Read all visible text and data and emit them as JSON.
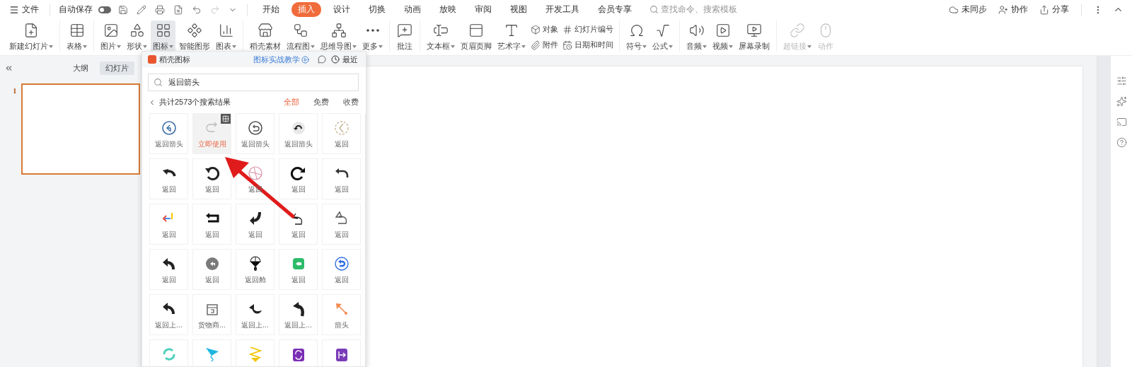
{
  "titlebar": {
    "menu": "文件",
    "autosave": {
      "label": "自动保存",
      "on": false
    },
    "tabs": [
      {
        "label": "开始",
        "selected": false
      },
      {
        "label": "插入",
        "selected": true
      },
      {
        "label": "设计",
        "selected": false
      },
      {
        "label": "切换",
        "selected": false
      },
      {
        "label": "动画",
        "selected": false
      },
      {
        "label": "放映",
        "selected": false
      },
      {
        "label": "审阅",
        "selected": false
      },
      {
        "label": "视图",
        "selected": false
      },
      {
        "label": "开发工具",
        "selected": false
      },
      {
        "label": "会员专享",
        "selected": false
      }
    ],
    "search": {
      "placeholder": "查找命令、搜索模板"
    },
    "actions": [
      "未同步",
      "协作",
      "分享"
    ]
  },
  "ribbon": [
    {
      "items": [
        {
          "kind": "large",
          "label": "新建幻灯片",
          "dropdown": true,
          "active": false,
          "disabled": false
        }
      ]
    },
    {
      "items": [
        {
          "kind": "large",
          "label": "表格",
          "dropdown": true,
          "active": false,
          "disabled": false
        }
      ]
    },
    {
      "items": [
        {
          "kind": "large",
          "label": "图片",
          "dropdown": true,
          "active": false,
          "disabled": false
        },
        {
          "kind": "large",
          "label": "形状",
          "dropdown": true,
          "active": false,
          "disabled": false
        },
        {
          "kind": "large",
          "label": "图标",
          "dropdown": true,
          "active": true,
          "disabled": false
        },
        {
          "kind": "large",
          "label": "智能图形",
          "dropdown": false,
          "active": false,
          "disabled": false
        },
        {
          "kind": "large",
          "label": "图表",
          "dropdown": true,
          "active": false,
          "disabled": false
        }
      ]
    },
    {
      "items": [
        {
          "kind": "large",
          "label": "稻壳素材",
          "dropdown": false,
          "active": false,
          "disabled": false
        },
        {
          "kind": "large",
          "label": "流程图",
          "dropdown": true,
          "active": false,
          "disabled": false
        },
        {
          "kind": "large",
          "label": "思维导图",
          "dropdown": true,
          "active": false,
          "disabled": false
        },
        {
          "kind": "large",
          "label": "更多",
          "dropdown": true,
          "active": false,
          "disabled": false
        }
      ]
    },
    {
      "items": [
        {
          "kind": "large",
          "label": "批注",
          "dropdown": false,
          "active": false,
          "disabled": false
        }
      ]
    },
    {
      "items": [
        {
          "kind": "large",
          "label": "文本框",
          "dropdown": true,
          "active": false,
          "disabled": false
        },
        {
          "kind": "large",
          "label": "页眉页脚",
          "dropdown": false,
          "active": false,
          "disabled": false
        },
        {
          "kind": "large",
          "label": "艺术字",
          "dropdown": true,
          "active": false,
          "disabled": false
        },
        {
          "kind": "stack",
          "rows": [
            "对象",
            "附件"
          ]
        },
        {
          "kind": "stack",
          "rows": [
            "幻灯片编号",
            "日期和时间"
          ]
        }
      ]
    },
    {
      "items": [
        {
          "kind": "large",
          "label": "符号",
          "dropdown": true,
          "active": false,
          "disabled": false
        },
        {
          "kind": "large",
          "label": "公式",
          "dropdown": true,
          "active": false,
          "disabled": false
        }
      ]
    },
    {
      "items": [
        {
          "kind": "large",
          "label": "音频",
          "dropdown": true,
          "active": false,
          "disabled": false
        },
        {
          "kind": "large",
          "label": "视频",
          "dropdown": true,
          "active": false,
          "disabled": false
        },
        {
          "kind": "large",
          "label": "屏幕录制",
          "dropdown": false,
          "active": false,
          "disabled": false
        }
      ]
    },
    {
      "items": [
        {
          "kind": "large",
          "label": "超链接",
          "dropdown": true,
          "active": false,
          "disabled": true
        },
        {
          "kind": "large",
          "label": "动作",
          "dropdown": false,
          "active": false,
          "disabled": true
        }
      ]
    }
  ],
  "left_pane": {
    "tabs": [
      {
        "label": "大纲",
        "selected": false
      },
      {
        "label": "幻灯片",
        "selected": true
      }
    ],
    "slides": [
      {
        "number": "1",
        "selected": true
      }
    ]
  },
  "icon_panel": {
    "title": "稻壳图标",
    "tutorial_link": "图标实战教学",
    "recent": "最近",
    "search": {
      "value": "返回箭头"
    },
    "result_count": "共计2573个搜索结果",
    "filters": [
      {
        "label": "全部",
        "selected": true
      },
      {
        "label": "免费",
        "selected": false
      },
      {
        "label": "收费",
        "selected": false
      }
    ],
    "cells": [
      {
        "label": "返回箭头",
        "hovered": false
      },
      {
        "label": "立即使用",
        "hovered": true
      },
      {
        "label": "返回箭头",
        "hovered": false
      },
      {
        "label": "返回箭头",
        "hovered": false
      },
      {
        "label": "返回",
        "hovered": false
      },
      {
        "label": "返回",
        "hovered": false
      },
      {
        "label": "返回",
        "hovered": false
      },
      {
        "label": "返回",
        "hovered": false
      },
      {
        "label": "返回",
        "hovered": false
      },
      {
        "label": "返回",
        "hovered": false
      },
      {
        "label": "返回",
        "hovered": false
      },
      {
        "label": "返回",
        "hovered": false
      },
      {
        "label": "返回",
        "hovered": false
      },
      {
        "label": "返回",
        "hovered": false
      },
      {
        "label": "返回",
        "hovered": false
      },
      {
        "label": "返回",
        "hovered": false
      },
      {
        "label": "返回",
        "hovered": false
      },
      {
        "label": "返回舱",
        "hovered": false
      },
      {
        "label": "返回",
        "hovered": false
      },
      {
        "label": "返回",
        "hovered": false
      },
      {
        "label": "返回上...",
        "hovered": false
      },
      {
        "label": "货物商...",
        "hovered": false
      },
      {
        "label": "返回上...",
        "hovered": false
      },
      {
        "label": "返回上...",
        "hovered": false
      },
      {
        "label": "箭头",
        "hovered": false
      },
      {
        "hovered": false
      },
      {
        "hovered": false
      },
      {
        "hovered": false
      },
      {
        "hovered": false
      },
      {
        "hovered": false
      }
    ]
  }
}
